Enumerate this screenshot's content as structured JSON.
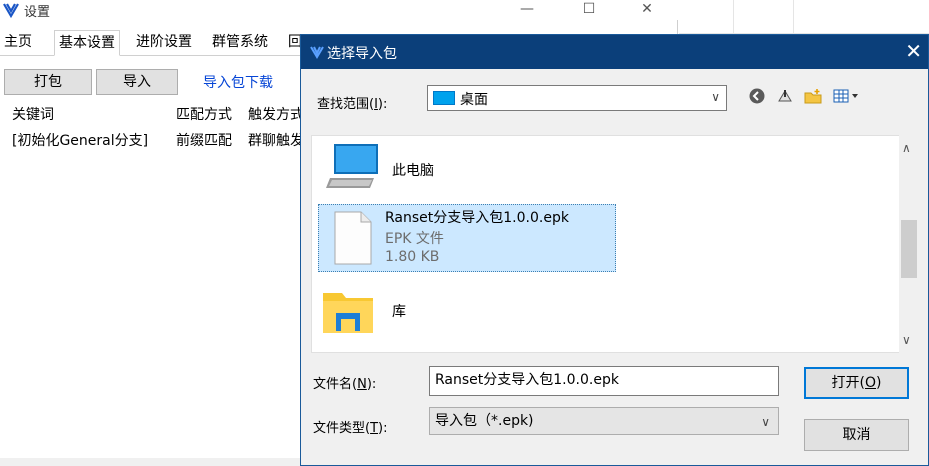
{
  "settings_window": {
    "title": "设置",
    "tabs": [
      "主页",
      "基本设置",
      "进阶设置",
      "群管系统",
      "回"
    ],
    "buttons": {
      "pack": "打包",
      "import": "导入"
    },
    "download_link": "导入包下载",
    "columns": [
      "关键词",
      "匹配方式",
      "触发方式"
    ],
    "rows": [
      [
        "[初始化General分支]",
        "前缀匹配",
        "群聊触发"
      ]
    ]
  },
  "dialog": {
    "title": "选择导入包",
    "look_in_label": "查找范围(I):",
    "look_in_label_main": "查找范围(",
    "look_in_key": "I",
    "look_in_tail": "):",
    "look_in_value": "桌面",
    "items": [
      {
        "name": "此电脑",
        "icon": "computer-icon"
      },
      {
        "name": "Ranset分支导入包1.0.0.epk",
        "type": "EPK 文件",
        "size": "1.80 KB",
        "icon": "file-icon"
      },
      {
        "name": "库",
        "icon": "folder-icon"
      }
    ],
    "filename_label_main": "文件名(",
    "filename_key": "N",
    "filename_tail": "):",
    "filename_value": "Ranset分支导入包1.0.0.epk",
    "filetype_label_main": "文件类型(",
    "filetype_key": "T",
    "filetype_tail": "):",
    "filetype_value": "导入包（*.epk)",
    "open_main": "打开(",
    "open_key": "O",
    "open_tail": ")",
    "cancel_label": "取消"
  },
  "colors": {
    "dialog_titlebar": "#0b3f7a",
    "selection": "#cce8ff",
    "link": "#0645d6"
  }
}
